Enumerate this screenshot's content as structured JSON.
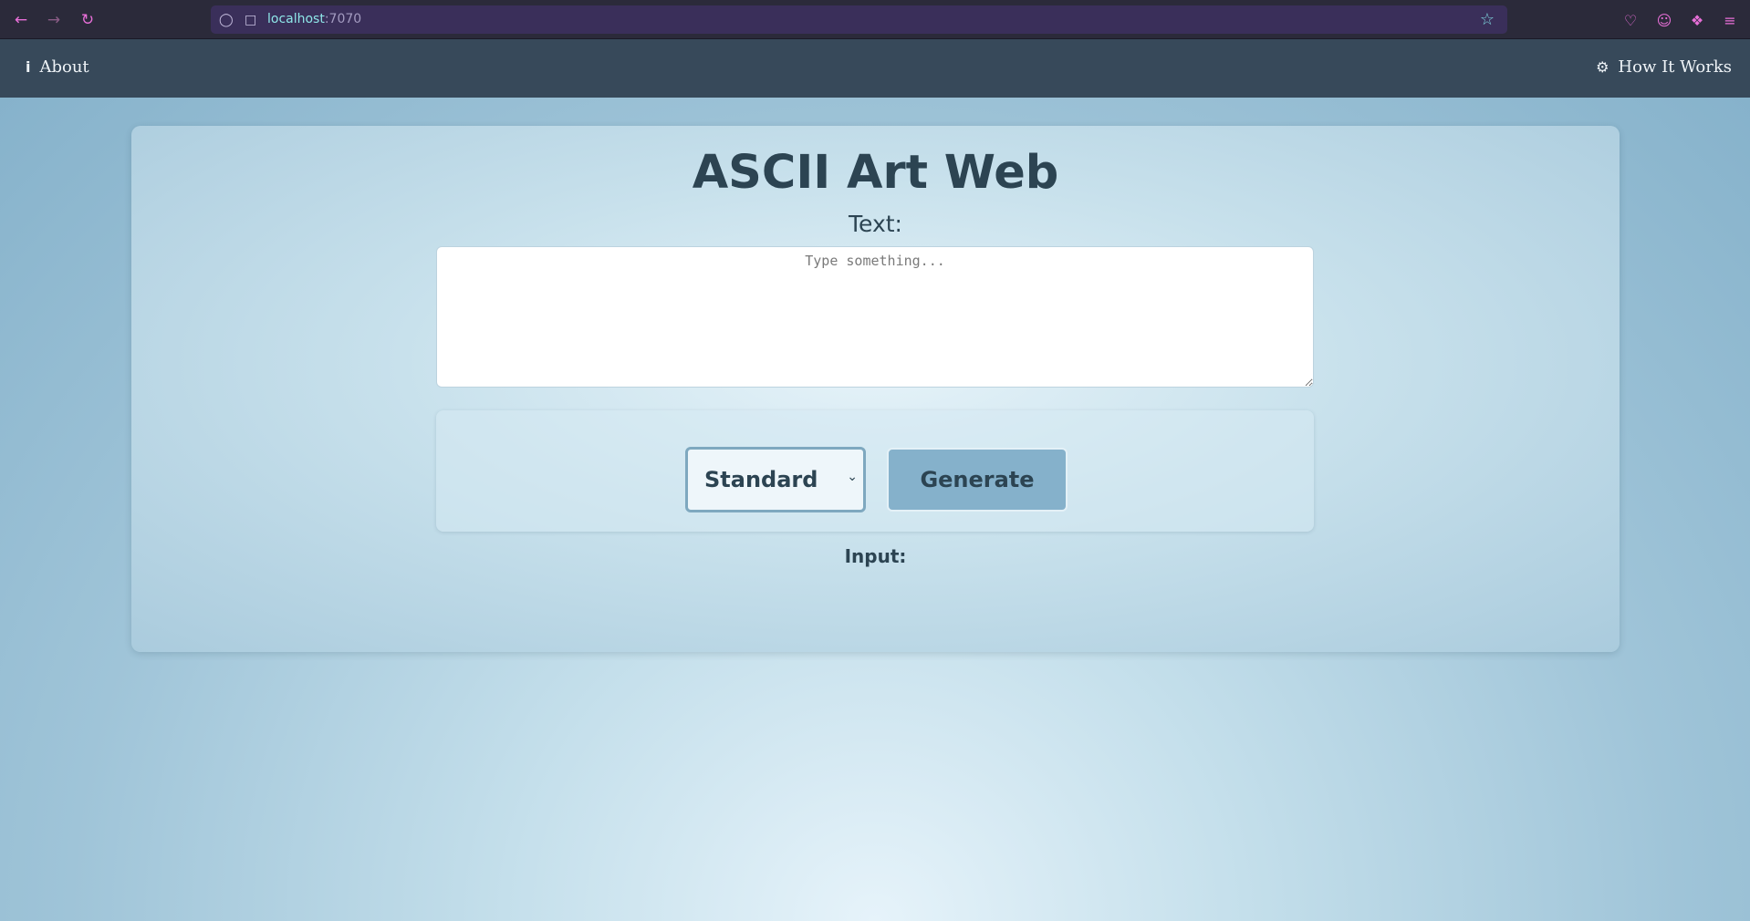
{
  "browser": {
    "url_host": "localhost",
    "url_port": ":7070"
  },
  "navbar": {
    "about_label": "About",
    "how_it_works_label": "How It Works"
  },
  "main": {
    "title": "ASCII Art Web",
    "text_label": "Text:",
    "textarea_placeholder": "Type something...",
    "banner_select_value": "Standard",
    "generate_label": "Generate",
    "input_label": "Input:"
  },
  "colors": {
    "navbar_bg": "#37495a",
    "heading_text": "#2c4452",
    "button_bg": "#85b1cb",
    "browser_accent": "#e86fd8"
  }
}
